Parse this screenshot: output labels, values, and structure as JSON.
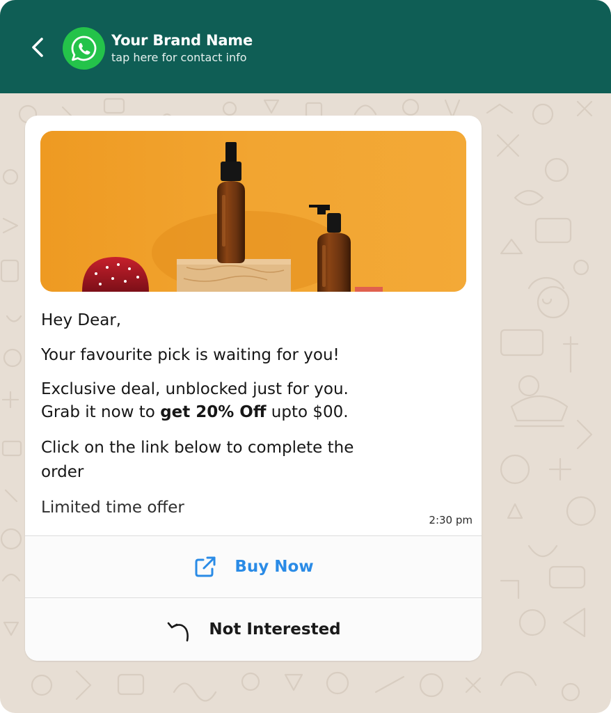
{
  "header": {
    "brand_name": "Your Brand Name",
    "subtitle": "tap here for contact info"
  },
  "message": {
    "greeting": "Hey Dear,",
    "line1": "Your favourite pick is waiting for you!",
    "deal_line1": "Exclusive deal, unblocked just for you.",
    "deal_line2_prefix": "Grab it now to ",
    "deal_line2_bold": "get 20% Off",
    "deal_line2_suffix": " upto $00.",
    "click_line1": "Click on the link below to complete the",
    "click_line2": "order",
    "limited": "Limited time offer",
    "time": "2:30 pm"
  },
  "actions": {
    "buy_now": "Buy Now",
    "not_interested": "Not Interested"
  },
  "colors": {
    "header_bg": "#0f5e55",
    "avatar_green": "#24c34a",
    "chat_bg": "#e7ded4",
    "link_blue": "#2a8be6",
    "hero_orange": "#f0a02a"
  },
  "icons": {
    "back": "chevron-left-icon",
    "avatar": "whatsapp-logo-icon",
    "buy": "external-link-icon",
    "not_interested": "reply-arrow-icon"
  }
}
